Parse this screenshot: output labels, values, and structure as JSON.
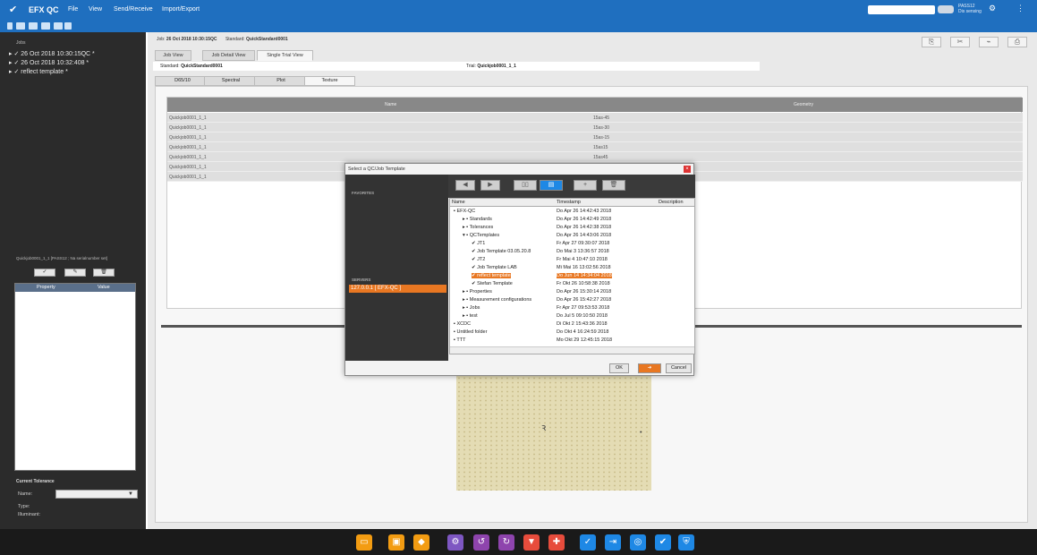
{
  "topbar": {
    "app_title": "EFX QC",
    "menu": [
      "File",
      "View",
      "Send/Receive",
      "Import/Export"
    ],
    "device_line1": "PASS12",
    "device_line2": "Dis sensing",
    "color": "#1f6fbf"
  },
  "left": {
    "jobs_label": "Jobs",
    "jobs": [
      "▸ ✓ 26 Oct 2018 10:30:15QC *",
      "▸ ✓ 26 Oct 2018 10:32:408 *",
      "▸ ✓ reflect template *"
    ],
    "selection_info": "Quickjob0001_1_1   [PASS12 ; Na serialnumber set]",
    "buttons": [
      "✓",
      "✎",
      "🗑"
    ],
    "prop_headers": [
      "Property",
      "Value"
    ],
    "current_tolerance": "Current Tolerance",
    "name_label": "Name:",
    "type_label": "Type:",
    "illuminant_label": "Illuminant:"
  },
  "jobbar": {
    "job_label": "Job:",
    "job_value": "26 Oct 2018 10:30:15QC",
    "standard_label": "Standard:",
    "standard_value": "QuickStandard0001"
  },
  "tabs": [
    "Job View",
    "Job Detail View",
    "Single Trial View"
  ],
  "stdrow": {
    "standard_label": "Standard:",
    "standard_value": "QuickStandard0001",
    "trial_label": "Trial:",
    "trial_value": "Quickjob0001_1_1"
  },
  "inner_tabs": [
    "D65/10",
    "Spectral",
    "Plot",
    "Texture"
  ],
  "grid": {
    "headers": [
      "Name",
      "Geometry"
    ],
    "rows": [
      [
        "Quickjob0001_1_1",
        "15as-45"
      ],
      [
        "Quickjob0001_1_1",
        "15as-30"
      ],
      [
        "Quickjob0001_1_1",
        "15as-15"
      ],
      [
        "Quickjob0001_1_1",
        "15as15"
      ],
      [
        "Quickjob0001_1_1",
        "15as45"
      ],
      [
        "Quickjob0001_1_1",
        ""
      ],
      [
        "Quickjob0001_1_1",
        ""
      ]
    ]
  },
  "dialog": {
    "title": "Select a QC/Job Template",
    "favorites": "FAVORITES",
    "servers": "SERVERS",
    "server": "127.0.0.1 [ EFX-QC ]",
    "list_headers": [
      "Name",
      "Timestamp",
      "Description"
    ],
    "items": [
      {
        "name": "▪ EFX-QC",
        "ts": "Do Apr 26 14:42:43 2018",
        "indent": 0
      },
      {
        "name": "▸ ▪ Standards",
        "ts": "Do Apr 26 14:42:49 2018",
        "indent": 1
      },
      {
        "name": "▸ ▪ Tolerances",
        "ts": "Do Apr 26 14:42:38 2018",
        "indent": 1
      },
      {
        "name": "▾ ▪ QCTemplates",
        "ts": "Do Apr 26 14:43:06 2018",
        "indent": 1
      },
      {
        "name": "✔ JT1",
        "ts": "Fr Apr 27 09:30:07 2018",
        "indent": 2
      },
      {
        "name": "✔ Job Template 03.05.20.8",
        "ts": "Do Mai 3 13:36:57 2018",
        "indent": 2
      },
      {
        "name": "✔ JT2",
        "ts": "Fr Mai 4 10:47:10 2018",
        "indent": 2
      },
      {
        "name": "✔ Job Template LAB",
        "ts": "Mi Mai 16 13:02:56 2018",
        "indent": 2
      },
      {
        "name": "✔ reflect template",
        "ts": "Do Jun 14 14:34:04 2018",
        "indent": 2,
        "selected": true
      },
      {
        "name": "✔ Stefan Template",
        "ts": "Fr Okt 26 10:58:38 2018",
        "indent": 2
      },
      {
        "name": "▸ ▪ Properties",
        "ts": "Do Apr 26 15:30:14 2018",
        "indent": 1
      },
      {
        "name": "▸ ▪ Measurement configurations",
        "ts": "Do Apr 26 15:42:27 2018",
        "indent": 1
      },
      {
        "name": "▸ ▪ Jobs",
        "ts": "Fr Apr 27 09:53:53 2018",
        "indent": 1
      },
      {
        "name": "▸ ▪ test",
        "ts": "Do Jul 5 09:10:50 2018",
        "indent": 1
      },
      {
        "name": "▪ XCDC",
        "ts": "Di Okt 2 15:43:36 2018",
        "indent": 0
      },
      {
        "name": "▪ Untitled folder",
        "ts": "Do Okt 4 16:24:59 2018",
        "indent": 0
      },
      {
        "name": "▪ TTT",
        "ts": "Mo Okt 29 12:45:15 2018",
        "indent": 0
      }
    ],
    "ok": "OK",
    "cancel": "Cancel",
    "accent": "#e87722"
  },
  "dock_icons": [
    "folder-icon",
    "save-icon",
    "tag-icon",
    "robot-icon",
    "arrow-icon",
    "arrow2-icon",
    "filter-icon",
    "tools-icon",
    "check-measure-icon",
    "import-icon",
    "shield-icon",
    "check-icon",
    "shield-check-icon"
  ]
}
